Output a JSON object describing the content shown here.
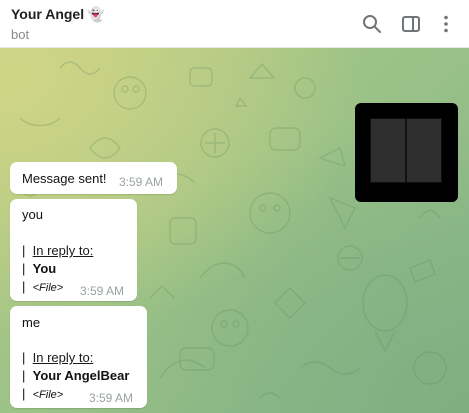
{
  "header": {
    "title": "Your Angel",
    "title_emoji": "👻",
    "subtitle": "bot",
    "icons": [
      "search-icon",
      "sidebar-panel-icon",
      "more-vertical-icon"
    ]
  },
  "colors": {
    "background_yellow": "#d0d585",
    "background_green": "#88b889",
    "bubble": "#ffffff",
    "time_text": "#9aa3a0"
  },
  "messages": [
    {
      "text": "Message sent!",
      "time": "3:59 AM"
    },
    {
      "text": "you",
      "reply_prefix": "|",
      "reply_label": "In reply to:",
      "reply_author": "You",
      "reply_content": "<File>",
      "time": "3:59 AM"
    },
    {
      "text": "me",
      "reply_prefix": "|",
      "reply_label": "In reply to:",
      "reply_author": "Your AngelBear",
      "reply_content": "<File>",
      "time": "3:59 AM"
    }
  ]
}
